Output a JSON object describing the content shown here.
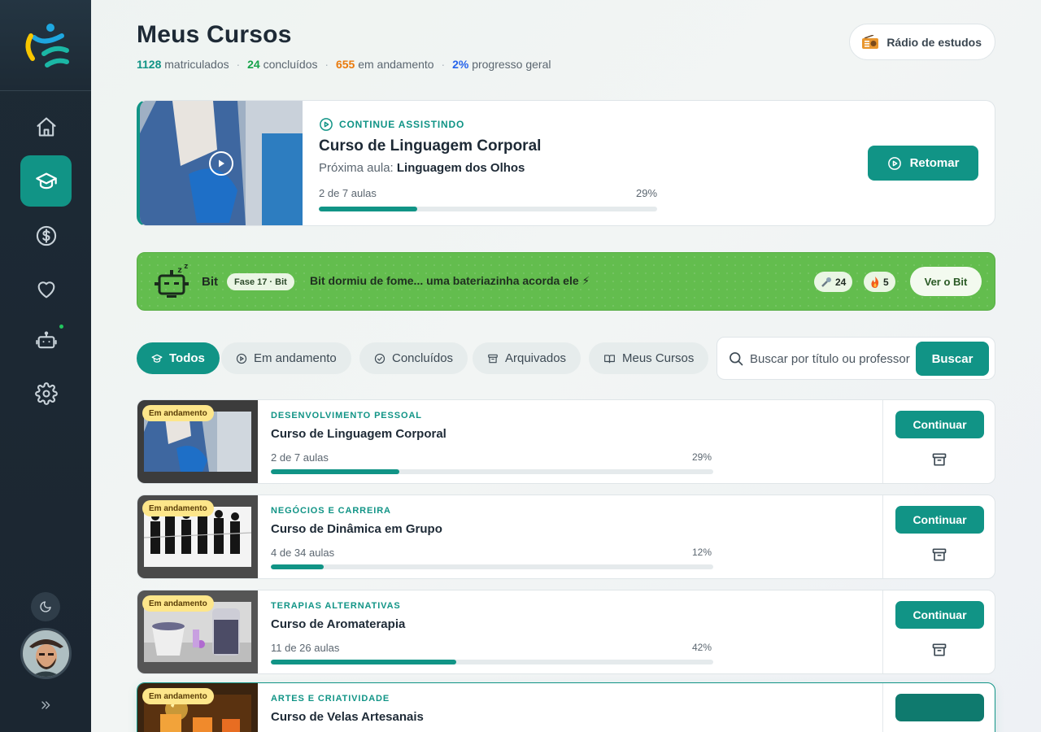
{
  "colors": {
    "accent": "#119486",
    "sidebar": "#1d2a35",
    "bit_banner": "#63bd4e",
    "status_tag": "#fde68a"
  },
  "sidebar": {
    "items": [
      {
        "name": "home",
        "icon": "home-icon",
        "active": false
      },
      {
        "name": "courses",
        "icon": "graduation-cap-icon",
        "active": true
      },
      {
        "name": "finance",
        "icon": "dollar-circle-icon",
        "active": false
      },
      {
        "name": "favorites",
        "icon": "heart-icon",
        "active": false
      },
      {
        "name": "bot",
        "icon": "robot-icon",
        "active": false
      },
      {
        "name": "settings",
        "icon": "gear-icon",
        "active": false
      }
    ]
  },
  "header": {
    "title": "Meus Cursos",
    "stats": {
      "enrolled_value": "1128",
      "enrolled_label": "matriculados",
      "completed_value": "24",
      "completed_label": "concluídos",
      "in_progress_value": "655",
      "in_progress_label": "em andamento",
      "progress_value": "2%",
      "progress_label": "progresso geral"
    },
    "radio_label": "Rádio de estudos"
  },
  "continue": {
    "eyebrow": "CONTINUE ASSISTINDO",
    "title": "Curso de Linguagem Corporal",
    "next_prefix": "Próxima aula:",
    "next_lesson": "Linguagem dos Olhos",
    "count": "2 de 7 aulas",
    "percent_label": "29%",
    "progress": 0.29,
    "button": "Retomar"
  },
  "bit": {
    "name": "Bit",
    "badge": "Fase 17 · Bit",
    "message": "Bit dormiu de fome... uma bateriazinha acorda ele ⚡",
    "chip_bolts": "24",
    "chip_streak": "5",
    "button": "Ver o Bit"
  },
  "filters": [
    {
      "label": "Todos",
      "icon": "graduation-cap-icon",
      "active": true
    },
    {
      "label": "Em andamento",
      "icon": "play-circle-icon",
      "active": false
    },
    {
      "label": "Concluídos",
      "icon": "check-circle-icon",
      "active": false
    },
    {
      "label": "Arquivados",
      "icon": "archive-icon",
      "active": false
    },
    {
      "label": "Meus Cursos",
      "icon": "book-open-icon",
      "active": false
    }
  ],
  "search": {
    "placeholder": "Buscar por título ou professor",
    "button": "Buscar"
  },
  "courses": [
    {
      "status": "Em andamento",
      "category": "DESENVOLVIMENTO PESSOAL",
      "title": "Curso de Linguagem Corporal",
      "count": "2 de 7 aulas",
      "percent_label": "29%",
      "progress": 0.29,
      "action": "Continuar"
    },
    {
      "status": "Em andamento",
      "category": "NEGÓCIOS E CARREIRA",
      "title": "Curso de Dinâmica em Grupo",
      "count": "4 de 34 aulas",
      "percent_label": "12%",
      "progress": 0.12,
      "action": "Continuar"
    },
    {
      "status": "Em andamento",
      "category": "TERAPIAS ALTERNATIVAS",
      "title": "Curso de Aromaterapia",
      "count": "11 de 26 aulas",
      "percent_label": "42%",
      "progress": 0.42,
      "action": "Continuar"
    },
    {
      "status": "Em andamento",
      "category": "ARTES E CRIATIVIDADE",
      "title": "Curso de Velas Artesanais",
      "count": "",
      "percent_label": "",
      "progress": 0,
      "action": ""
    }
  ]
}
